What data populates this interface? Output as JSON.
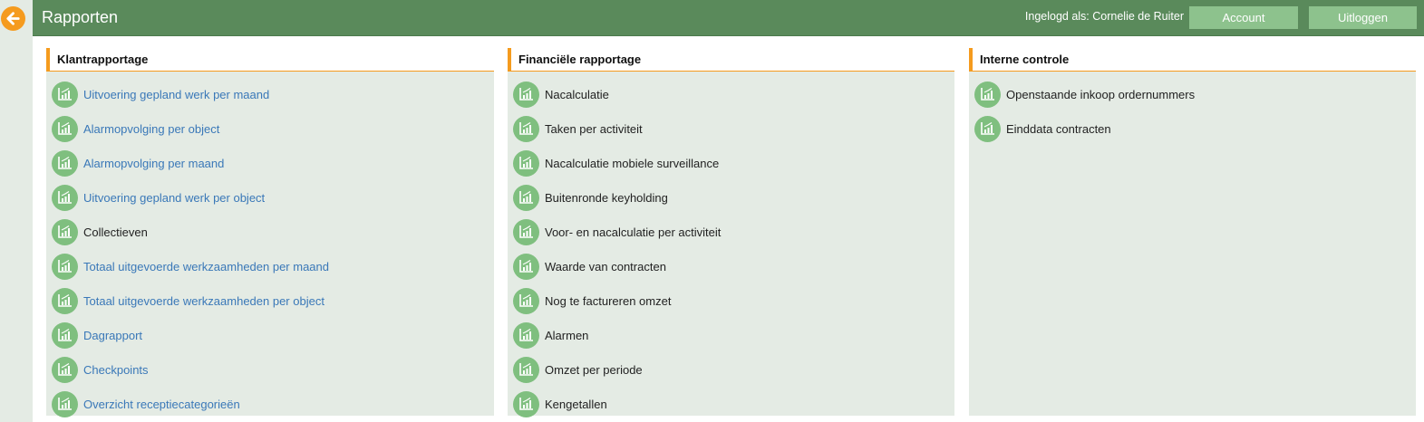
{
  "header": {
    "title": "Rapporten",
    "login_text": "Ingelogd als: Cornelie de Ruiter",
    "account_label": "Account",
    "logout_label": "Uitloggen"
  },
  "colors": {
    "header_bg": "#5a8a5b",
    "button_bg": "#8dc28d",
    "panel_bg": "#e4ebe4",
    "accent": "#f59b1e",
    "link": "#3a78b8",
    "icon_bg": "#7fbf7f"
  },
  "icons": {
    "back": "arrow-left-icon",
    "report": "bar-chart-icon"
  },
  "columns": [
    {
      "title": "Klantrapportage",
      "items": [
        {
          "label": "Uitvoering gepland werk per maand",
          "style": "link"
        },
        {
          "label": "Alarmopvolging per object",
          "style": "link"
        },
        {
          "label": "Alarmopvolging per maand",
          "style": "link"
        },
        {
          "label": "Uitvoering gepland werk per object",
          "style": "link"
        },
        {
          "label": "Collectieven",
          "style": "plain"
        },
        {
          "label": "Totaal uitgevoerde werkzaamheden per maand",
          "style": "link"
        },
        {
          "label": "Totaal uitgevoerde werkzaamheden per object",
          "style": "link"
        },
        {
          "label": "Dagrapport",
          "style": "link"
        },
        {
          "label": "Checkpoints",
          "style": "link"
        },
        {
          "label": "Overzicht receptiecategorieën",
          "style": "link"
        }
      ]
    },
    {
      "title": "Financiële rapportage",
      "items": [
        {
          "label": "Nacalculatie",
          "style": "plain"
        },
        {
          "label": "Taken per activiteit",
          "style": "plain"
        },
        {
          "label": "Nacalculatie mobiele surveillance",
          "style": "plain"
        },
        {
          "label": "Buitenronde keyholding",
          "style": "plain"
        },
        {
          "label": "Voor- en nacalculatie per activiteit",
          "style": "plain"
        },
        {
          "label": "Waarde van contracten",
          "style": "plain"
        },
        {
          "label": "Nog te factureren omzet",
          "style": "plain"
        },
        {
          "label": "Alarmen",
          "style": "plain"
        },
        {
          "label": "Omzet per periode",
          "style": "plain"
        },
        {
          "label": "Kengetallen",
          "style": "plain"
        }
      ]
    },
    {
      "title": "Interne controle",
      "items": [
        {
          "label": "Openstaande inkoop ordernummers",
          "style": "plain"
        },
        {
          "label": "Einddata contracten",
          "style": "plain"
        }
      ]
    }
  ]
}
